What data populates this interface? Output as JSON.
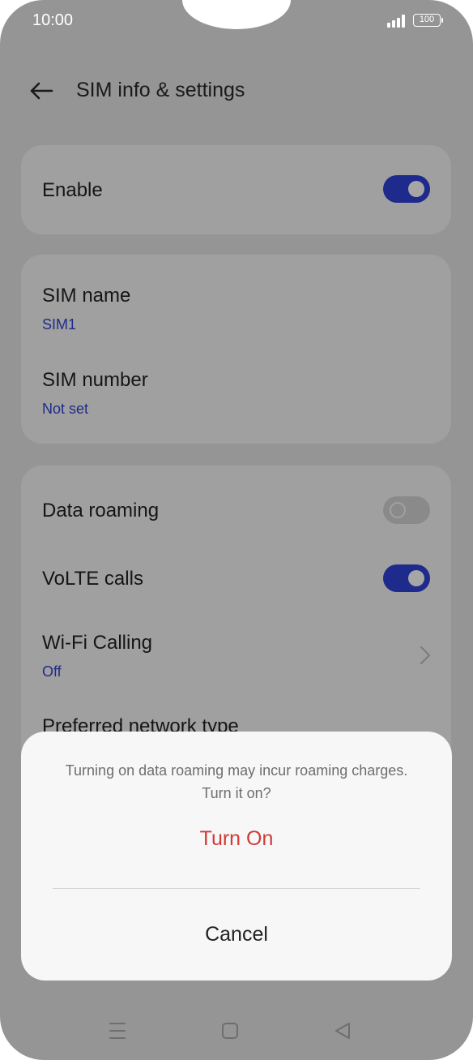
{
  "status_bar": {
    "time": "10:00",
    "battery": "100"
  },
  "header": {
    "title": "SIM info & settings"
  },
  "enable_card": {
    "label": "Enable",
    "toggle": "on"
  },
  "sim_card": {
    "items": [
      {
        "label": "SIM name",
        "value": "SIM1"
      },
      {
        "label": "SIM number",
        "value": "Not set"
      }
    ]
  },
  "network_card": {
    "data_roaming": {
      "label": "Data roaming",
      "toggle": "off"
    },
    "volte": {
      "label": "VoLTE calls",
      "toggle": "on"
    },
    "wifi_calling": {
      "label": "Wi-Fi Calling",
      "value": "Off"
    },
    "preferred_network": {
      "label": "Preferred network type"
    }
  },
  "dialog": {
    "message": "Turning on data roaming may incur roaming charges. Turn it on?",
    "confirm": "Turn On",
    "cancel": "Cancel"
  },
  "colors": {
    "accent": "#1e2a8c",
    "danger": "#d23a35",
    "overlay": "#959595"
  },
  "icons": [
    "back-arrow-icon",
    "chevron-right-icon",
    "menu-icon",
    "home-square-icon",
    "back-triangle-icon"
  ]
}
